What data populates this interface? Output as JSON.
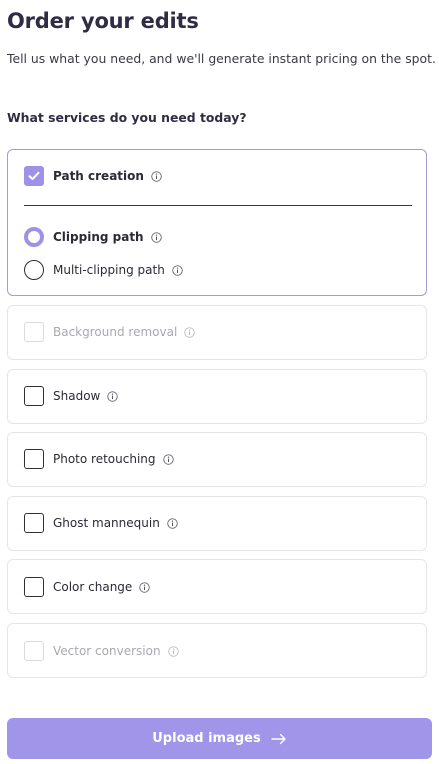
{
  "page": {
    "title": "Order your edits",
    "subtitle": "Tell us what you need, and we'll generate instant pricing on the spot.",
    "question": "What services do you need today?"
  },
  "services": {
    "path_creation": {
      "label": "Path creation",
      "checked": true,
      "options": [
        {
          "label": "Clipping path",
          "selected": true
        },
        {
          "label": "Multi-clipping path",
          "selected": false
        }
      ]
    },
    "background_removal": {
      "label": "Background removal",
      "checked": false,
      "disabled": true
    },
    "shadow": {
      "label": "Shadow",
      "checked": false,
      "disabled": false
    },
    "photo_retouching": {
      "label": "Photo retouching",
      "checked": false,
      "disabled": false
    },
    "ghost_mannequin": {
      "label": "Ghost mannequin",
      "checked": false,
      "disabled": false
    },
    "color_change": {
      "label": "Color change",
      "checked": false,
      "disabled": false
    },
    "vector_conversion": {
      "label": "Vector conversion",
      "checked": false,
      "disabled": true
    }
  },
  "upload_button": {
    "label": "Upload images",
    "icon": "arrow-right-icon"
  },
  "colors": {
    "accent": "#9f92e6",
    "button": "#a095e8",
    "title": "#2f2c44",
    "disabled_text": "#a8a8b0"
  }
}
